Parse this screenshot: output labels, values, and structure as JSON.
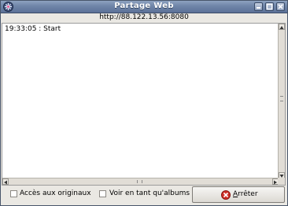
{
  "window": {
    "title": "Partage Web"
  },
  "server": {
    "url": "http://88.122.13.56:8080"
  },
  "log": {
    "lines": [
      "19:33:05 : Start"
    ]
  },
  "options": {
    "originals_label": "Accès aux originaux",
    "originals_checked": false,
    "albums_label": "Voir en tant qu'albums",
    "albums_checked": false
  },
  "actions": {
    "stop_label": "Arrêter",
    "stop_accelerator": "A"
  },
  "icons": {
    "app": "web-share-app-icon",
    "minimize": "minimize-icon",
    "maximize": "maximize-icon",
    "close": "close-icon",
    "stop": "stop-icon"
  },
  "colors": {
    "titlebar": "#6f85a8",
    "stop_icon": "#d03028"
  }
}
